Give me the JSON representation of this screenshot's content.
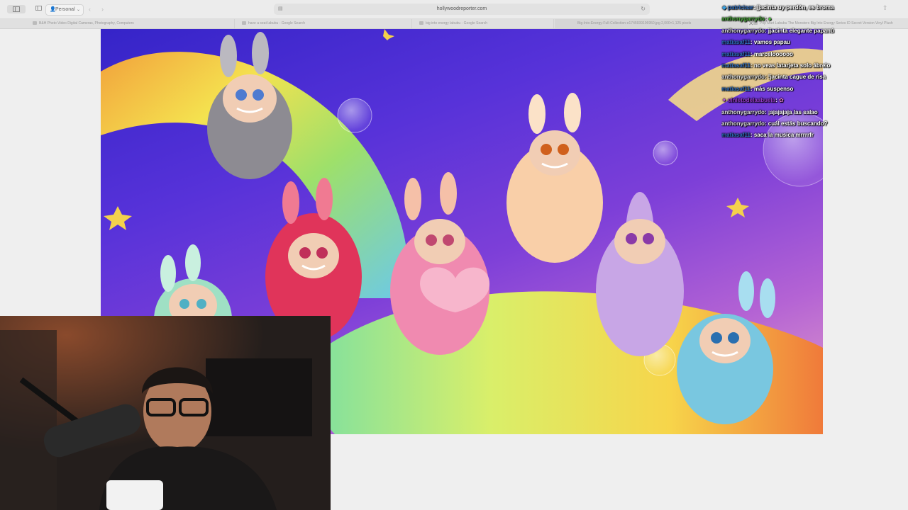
{
  "browser": {
    "profile_label": "Personal",
    "url": "hollywoodreporter.com",
    "tabs": [
      {
        "title": "B&H Photo Video Digital Cameras, Photography, Computers",
        "active": false
      },
      {
        "title": "have a seat labubu - Google Search",
        "active": false
      },
      {
        "title": "big into energy labubu - Google Search",
        "active": false
      },
      {
        "title": "Big-Into-Energy-Full-Collection-e1745939106950.jpg 2,000×1,125 pixels",
        "active": true
      },
      {
        "title": "Pop Mart Labubu The Monsters Big Into Energy Series ID Secret Version Vinyl Plush",
        "active": false
      }
    ],
    "icons": {
      "sidebar": "sidebar-icon",
      "tab_overview": "tab-overview-icon",
      "profile": "person-icon",
      "back": "chevron-left-icon",
      "forward": "chevron-right-icon",
      "page": "page-icon",
      "reload": "reload-icon",
      "share": "share-icon",
      "close": "close-icon"
    }
  },
  "chat": {
    "messages": [
      {
        "icon": "shield-icon",
        "icon_glyph": "◆",
        "user": "patriciaar",
        "user_color": "#2f6fbf",
        "text": "jjacinta uy perdón, es broma"
      },
      {
        "icon": "",
        "icon_glyph": "",
        "user": "anthonygarrydo",
        "user_color": "#49a83a",
        "text": "●"
      },
      {
        "icon": "",
        "icon_glyph": "",
        "user": "anthonygarrydo",
        "user_color": "#dcdcdc",
        "text": "jjacinta elegante papanú"
      },
      {
        "icon": "",
        "icon_glyph": "",
        "user": "matiasaf11",
        "user_color": "#2f6fbf",
        "text": "vamos papau"
      },
      {
        "icon": "",
        "icon_glyph": "",
        "user": "matiasaf11",
        "user_color": "#2f6fbf",
        "text": "marceloooooo"
      },
      {
        "icon": "",
        "icon_glyph": "",
        "user": "matiasaf11",
        "user_color": "#2f6fbf",
        "text": "no veas latarjeta solo ábrelo"
      },
      {
        "icon": "",
        "icon_glyph": "",
        "user": "anthonygarrydo",
        "user_color": "#dcdcdc",
        "text": "!jacinta cague de risa"
      },
      {
        "icon": "",
        "icon_glyph": "",
        "user": "matiasaf11",
        "user_color": "#2f6fbf",
        "text": "más suspenso"
      },
      {
        "icon": "sparkle-icon",
        "icon_glyph": "✦",
        "user": "elnietodelaabuela",
        "user_color": "#9a3bd0",
        "text": "✿"
      },
      {
        "icon": "",
        "icon_glyph": "",
        "user": "anthonygarrydo",
        "user_color": "#dcdcdc",
        "text": "¡ajajajaja las salao"
      },
      {
        "icon": "",
        "icon_glyph": "",
        "user": "anthonygarrydo",
        "user_color": "#dcdcdc",
        "text": "cuál estás buscando?"
      },
      {
        "icon": "",
        "icon_glyph": "",
        "user": "matiasaf11",
        "user_color": "#2f6fbf",
        "text": "saca la musica mrrrrfr"
      }
    ]
  },
  "colors": {
    "browser_bg": "#ececec",
    "hero_blue": "#3524c8",
    "hero_purple": "#7d3fd8"
  }
}
